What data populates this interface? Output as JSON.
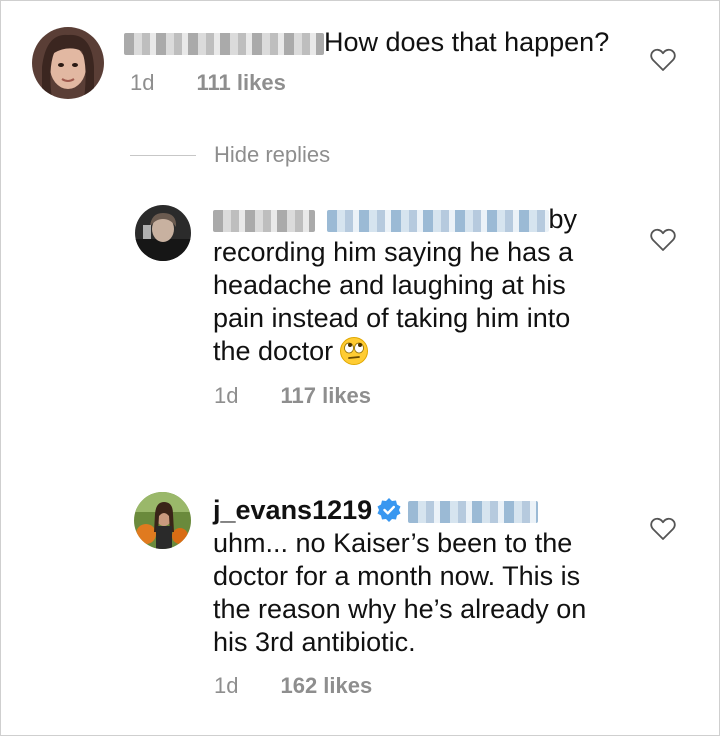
{
  "comments": [
    {
      "username": "",
      "text": "How does that happen?",
      "time": "1d",
      "likes": "111 likes"
    },
    {
      "username": "",
      "text_lines": [
        "by",
        "recording him saying he has a",
        "headache and laughing at his",
        "pain instead of taking him into",
        "the doctor"
      ],
      "emoji": "face-with-rolling-eyes",
      "time": "1d",
      "likes": "117 likes"
    },
    {
      "username": "j_evans1219",
      "verified": true,
      "text_lines": [
        "uhm... no Kaiser’s been to the",
        "doctor for a month now. This is",
        "the reason why he’s already on",
        "his 3rd antibiotic."
      ],
      "time": "1d",
      "likes": "162 likes"
    }
  ],
  "thread": {
    "hide_replies_label": "Hide replies"
  },
  "icons": {
    "like": "heart-icon",
    "verified": "verified-badge-icon"
  },
  "colors": {
    "meta_text": "#8e8e8e",
    "verified_blue": "#3897f0"
  }
}
